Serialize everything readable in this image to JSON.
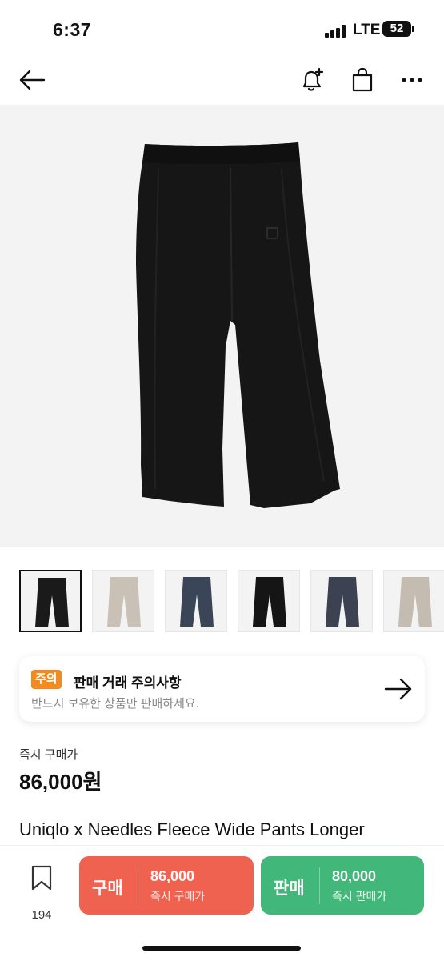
{
  "status_bar": {
    "time": "6:37",
    "network": "LTE",
    "battery": "52"
  },
  "nav": {
    "back_icon": "arrow-left-icon",
    "alert_icon": "bell-plus-icon",
    "bag_icon": "shopping-bag-icon",
    "more_icon": "more-horizontal-icon"
  },
  "gallery": {
    "thumbnails": [
      {
        "color": "#1a1a1a",
        "selected": true
      },
      {
        "color": "#c9c1b5",
        "selected": false
      },
      {
        "color": "#3b4558",
        "selected": false
      },
      {
        "color": "#151515",
        "selected": false
      },
      {
        "color": "#3c4252",
        "selected": false
      },
      {
        "color": "#c4bcb0",
        "selected": false
      }
    ]
  },
  "notice": {
    "badge": "주의",
    "title": "판매 거래 주의사항",
    "description": "반드시 보유한 상품만 판매하세요."
  },
  "price": {
    "label": "즉시 구매가",
    "value": "86,000원"
  },
  "product": {
    "title": "Uniqlo x Needles Fleece Wide Pants Longer"
  },
  "bottom_bar": {
    "wishlist_count": "194",
    "buy": {
      "label": "구매",
      "price": "86,000",
      "sub": "즉시 구매가"
    },
    "sell": {
      "label": "판매",
      "price": "80,000",
      "sub": "즉시 판매가"
    }
  },
  "colors": {
    "buy": "#ef6250",
    "sell": "#41b879",
    "badge": "#f28a1e"
  }
}
